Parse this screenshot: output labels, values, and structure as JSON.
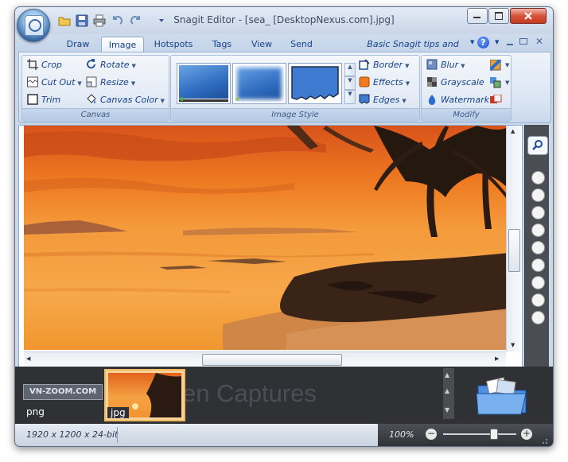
{
  "window": {
    "title": "Snagit Editor - [sea_ [DesktopNexus.com].jpg]"
  },
  "quick_access": [
    "open-folder-icon",
    "save-icon",
    "print-icon",
    "undo-icon",
    "redo-icon",
    "customize-icon"
  ],
  "tabs": [
    {
      "label": "Draw"
    },
    {
      "label": "Image",
      "selected": true
    },
    {
      "label": "Hotspots"
    },
    {
      "label": "Tags"
    },
    {
      "label": "View"
    },
    {
      "label": "Send"
    }
  ],
  "help_link": "Basic Snagit tips and tricks",
  "ribbon": {
    "canvas": {
      "label": "Canvas",
      "crop": "Crop",
      "rotate": "Rotate",
      "cut_out": "Cut Out",
      "resize": "Resize",
      "trim": "Trim",
      "canvas_color": "Canvas Color"
    },
    "image_style": {
      "label": "Image Style",
      "border": "Border",
      "effects": "Effects",
      "edges": "Edges"
    },
    "modify": {
      "label": "Modify",
      "blur": "Blur",
      "grayscale": "Grayscale",
      "watermark": "Watermark"
    }
  },
  "tray": {
    "background_text": "en Captures",
    "items": [
      {
        "label": "png",
        "logo_text": "VN-ZOOM.COM"
      },
      {
        "label": "jpg",
        "selected": true
      }
    ]
  },
  "status": {
    "dimensions": "1920 x 1200 x 24-bit",
    "zoom": "100%",
    "zoom_level": 0.72
  },
  "colors": {
    "accent": "#15428b",
    "ribbon_bg": "#dae5f3",
    "sky_orange": "#f07a1e",
    "tray_bg": "#2f3134"
  }
}
